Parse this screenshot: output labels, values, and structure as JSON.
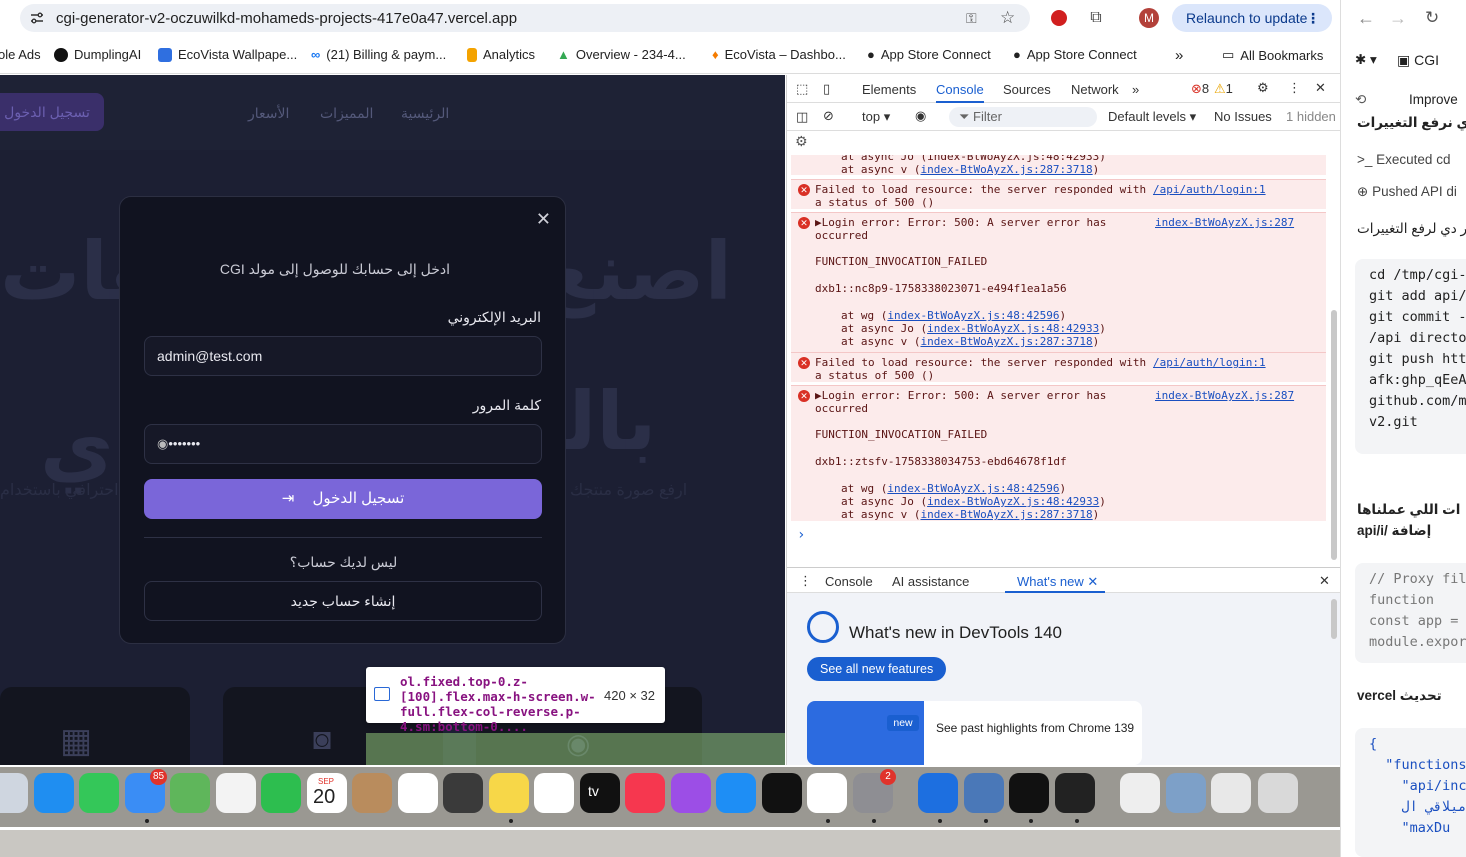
{
  "browser": {
    "url": "cgi-generator-v2-oczuwilkd-mohameds-projects-417e0a47.vercel.app",
    "relaunch_label": "Relaunch to update",
    "profile_initial": "M",
    "bookmarks": [
      {
        "label": "ole Ads",
        "color": "#ffffff"
      },
      {
        "label": "DumplingAI",
        "color": "#111111"
      },
      {
        "label": "EcoVista Wallpape...",
        "color": "#2f6fe0"
      },
      {
        "label": "(21) Billing & paym...",
        "color": "#1877f2"
      },
      {
        "label": "Analytics",
        "color": "#f4a300"
      },
      {
        "label": "Overview - 234-4...",
        "color": "#34a853"
      },
      {
        "label": "EcoVista – Dashbo...",
        "color": "#f57c00"
      },
      {
        "label": "App Store Connect",
        "color": "#333333"
      },
      {
        "label": "App Store Connect",
        "color": "#333333"
      }
    ],
    "more_bookmarks": "»",
    "all_bookmarks": "All Bookmarks"
  },
  "site": {
    "nav": [
      "الرئيسية",
      "المميزات",
      "الأسعار"
    ],
    "nav_login": "تسجيل الدخول",
    "hero_word1": "اصنع",
    "hero_word2": "هات",
    "hero_word3": "بالذ",
    "hero_word4": "ي",
    "hero_sub1": "ارفع صورة منتجك",
    "hero_sub2": "احترافي باستخدام"
  },
  "login_modal": {
    "close": "✕",
    "subtitle": "ادخل إلى حسابك للوصول إلى مولد CGI",
    "email_label": "البريد الإلكتروني",
    "email_value": "admin@test.com",
    "password_label": "كلمة المرور",
    "password_value": "•••••••",
    "login_button": "تسجيل الدخول",
    "no_account": "ليس لديك حساب؟",
    "signup_button": "إنشاء حساب جديد"
  },
  "inspect_tooltip": {
    "selector": "ol.fixed.top-0.z-[100].flex.max-h-screen.w-full.flex-col-reverse.p-4.sm:bottom-0....",
    "size": "420 × 32"
  },
  "devtools": {
    "tabs": [
      "Elements",
      "Console",
      "Sources",
      "Network"
    ],
    "active_tab": "Console",
    "error_count": "8",
    "warning_count": "1",
    "context": "top",
    "filter_placeholder": "Filter",
    "levels": "Default levels",
    "issues": "No Issues",
    "hidden": "1 hidden",
    "console_lines": {
      "top1": "at async Jo (index-BtWoAyzX.js:48:42933)",
      "top2_prefix": "at async v (",
      "top2_link": "index-BtWoAyzX.js:287:3718",
      "fail1a": "Failed to load resource: the server responded with",
      "fail1b": "a status of 500 ()",
      "fail_link": "/api/auth/login:1",
      "err_a": "▶Login error: Error: 500: A server error has",
      "err_b": "occurred",
      "err_link": "index-BtWoAyzX.js:287",
      "func_failed": "FUNCTION_INVOCATION_FAILED",
      "id1": "dxb1::nc8p9-1758338023071-e494f1ea1a56",
      "id2": "dxb1::ztsfv-1758338034753-ebd64678f1df",
      "wg_prefix": "at wg (",
      "wg_link": "index-BtWoAyzX.js:48:42596",
      "jo_prefix": "at async Jo (",
      "jo_link": "index-BtWoAyzX.js:48:42933",
      "v_prefix": "at async v (",
      "v_link": "index-BtWoAyzX.js:287:3718",
      "close_paren": ")"
    },
    "prompt": "›",
    "drawer_tabs": [
      "Console",
      "AI assistance",
      "What's new"
    ],
    "whats_new_title": "What's new in DevTools 140",
    "see_all": "See all new features",
    "new_badge": "new",
    "past_highlights": "See past highlights from Chrome 139"
  },
  "side_panel": {
    "title": "CGI",
    "improve": "Improve",
    "push_text": "ي نرفع التغييرات",
    "executed": "Executed cd",
    "pushed": "Pushed API di",
    "commands_text": "وامر دي لرفع التغييرات",
    "code1": "cd /tmp/cgi-\ngit add api/\ngit commit -\n/api directo\ngit push htt\nafk:ghp_qEeA\ngithub.com/m\nv2.git",
    "done_text": "ات اللي عملناها",
    "added_text": "إضافة /api/i",
    "code2": "// Proxy fil\nfunction\nconst app =\nmodule.expor",
    "update_text": "تحديث vercel",
    "code3": "{\n  \"functions\n    \"api/inc\n    ميلاقي ال  fu\n    \"maxDu"
  },
  "dock": {
    "mail_badge": "85",
    "calendar_month": "SEP",
    "calendar_day": "20",
    "settings_badge": "2",
    "tv_label": "tv"
  }
}
